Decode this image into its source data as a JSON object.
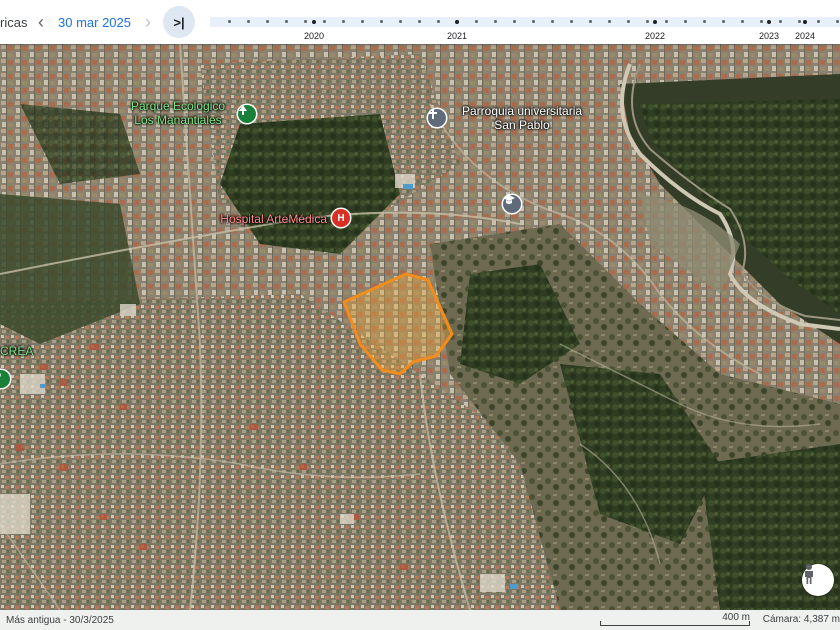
{
  "toolbar": {
    "left_label": "ricas",
    "date": "30 mar 2025",
    "prev_icon": "chevron-left-icon",
    "next_icon": "chevron-right-icon",
    "latest_icon": "skip-to-latest-icon",
    "latest_glyph": ">|"
  },
  "timeline": {
    "years": [
      {
        "label": "2020"
      },
      {
        "label": "2021"
      },
      {
        "label": "2022"
      },
      {
        "label": "2023"
      },
      {
        "label": "2024"
      }
    ]
  },
  "map": {
    "pois": [
      {
        "name": "poi-parque",
        "line1": "Parque Ecologico",
        "line2": "Los Manantiales",
        "icon": "tree-icon"
      },
      {
        "name": "poi-parroquia",
        "line1": "Parroquia universitaria",
        "line2": "San Pablo",
        "icon": "church-icon"
      },
      {
        "name": "poi-hospital",
        "line1": "Hospital ArteMédica",
        "icon": "hospital-icon",
        "glyph": "H"
      },
      {
        "name": "poi-crea",
        "line1": "CREA",
        "icon": "education-icon"
      }
    ],
    "highlight_color": "#f28c1a",
    "pegman_icon": "pegman-icon"
  },
  "footer": {
    "oldest": "Más antigua - 30/3/2025",
    "scale_label": "400 m",
    "camera": "Cámara: 4,387 m"
  }
}
